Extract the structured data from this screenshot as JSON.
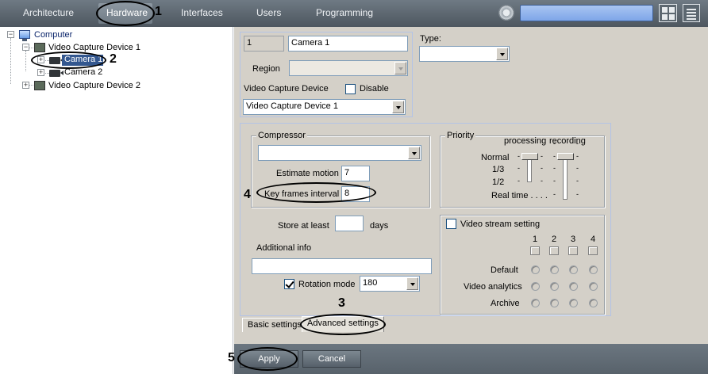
{
  "nav": {
    "tabs": [
      "Architecture",
      "Hardware",
      "Interfaces",
      "Users",
      "Programming"
    ]
  },
  "tree": {
    "computer": "Computer",
    "vcd1": "Video Capture Device 1",
    "camera1": "Camera 1",
    "camera2": "Camera 2",
    "vcd2": "Video Capture Device 2"
  },
  "camera": {
    "number": "1",
    "name": "Camera 1",
    "region_label": "Region",
    "region_value": "",
    "vcd_label": "Video Capture Device",
    "disable_label": "Disable",
    "vcd_value": "Video Capture Device 1",
    "type_label": "Type:",
    "type_value": ""
  },
  "compressor": {
    "legend": "Compressor",
    "value": "",
    "estimate_label": "Estimate motion",
    "estimate_value": "7",
    "keyframes_label": "Key frames interval",
    "keyframes_value": "8"
  },
  "priority": {
    "legend": "Priority",
    "col_processing": "processing",
    "col_recording": "recording",
    "rows": [
      "Normal",
      "1/3",
      "1/2",
      "Real time . . . ."
    ],
    "tick": "-"
  },
  "store": {
    "label": "Store at least",
    "value": "",
    "unit": "days"
  },
  "additional": {
    "label": "Additional info",
    "value": ""
  },
  "rotation": {
    "label": "Rotation mode",
    "value": "180",
    "checked": true
  },
  "video_stream": {
    "label": "Video stream setting",
    "checked": false,
    "columns": [
      "1",
      "2",
      "3",
      "4"
    ],
    "rows": [
      "Default",
      "Video analytics",
      "Archive"
    ]
  },
  "tabs": {
    "basic": "Basic settings",
    "advanced": "Advanced settings"
  },
  "buttons": {
    "apply": "Apply",
    "cancel": "Cancel"
  },
  "annotations": [
    "1",
    "2",
    "3",
    "4",
    "5"
  ],
  "colors": {
    "topbar": "#5a646d",
    "panel": "#d4d0c8",
    "selection": "#33578f",
    "search": "#7ea6e8"
  }
}
